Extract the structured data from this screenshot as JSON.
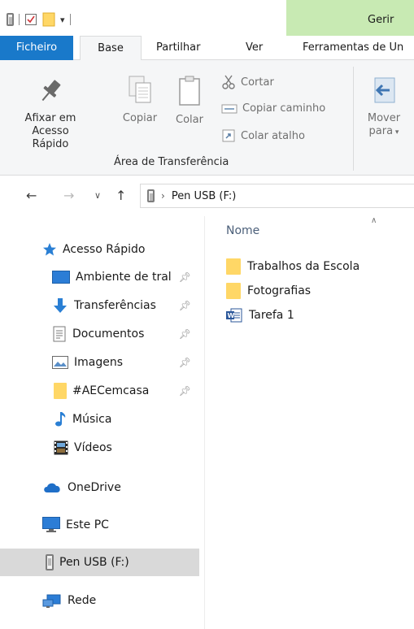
{
  "ribbon_tabs": {
    "file": "Ficheiro",
    "home": "Base",
    "share": "Partilhar",
    "view": "Ver",
    "tools": "Ferramentas de Un",
    "manage": "Gerir"
  },
  "ribbon": {
    "pin_line1": "Afixar em",
    "pin_line2": "Acesso Rápido",
    "copy": "Copiar",
    "paste": "Colar",
    "cut": "Cortar",
    "copy_path": "Copiar caminho",
    "paste_shortcut": "Colar atalho",
    "group_label": "Área de Transferência",
    "move_line1": "Mover",
    "move_line2": "para"
  },
  "address": {
    "location": "Pen USB (F:)"
  },
  "nav_pane": {
    "quick_access": "Acesso Rápido",
    "desktop": "Ambiente de tral",
    "downloads": "Transferências",
    "documents": "Documentos",
    "pictures": "Imagens",
    "aec": "#AECemcasa",
    "music": "Música",
    "videos": "Vídeos",
    "onedrive": "OneDrive",
    "this_pc": "Este PC",
    "usb": "Pen USB (F:)",
    "network": "Rede"
  },
  "content": {
    "column_name": "Nome",
    "files": [
      {
        "name": "Trabalhos da Escola",
        "icon": "folder-icon"
      },
      {
        "name": "Fotografias",
        "icon": "folder-icon"
      },
      {
        "name": "Tarefa 1",
        "icon": "word-document-icon"
      }
    ]
  },
  "colors": {
    "file_tab": "#1979ca",
    "manage_band": "#c8eab3",
    "selected_item": "#d9d9d9",
    "column_header": "#4c607a"
  }
}
